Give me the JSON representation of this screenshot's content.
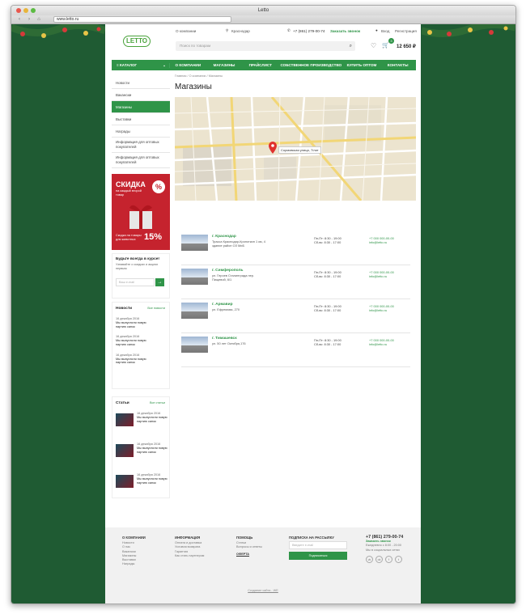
{
  "window": {
    "title": "Letto",
    "url": "www.letto.ru"
  },
  "topbar": {
    "about": "О компании",
    "city": "Краснодар",
    "phone": "+7 (861) 279-00-74",
    "callback": "Заказать звонок",
    "login": "Вход",
    "register": "Регистрация"
  },
  "header": {
    "logo": "LETTO",
    "search_placeholder": "Поиск по товарам",
    "cart_count": "3",
    "cart_total": "12 650 ₽"
  },
  "mainnav": {
    "catalog": "КАТАЛОГ",
    "items": [
      "О КОМПАНИИ",
      "МАГАЗИНЫ",
      "ПРАЙСЛИСТ",
      "СОБСТВЕННОЕ ПРОИЗВОДСТВО",
      "КУПИТЬ ОПТОМ",
      "КОНТАКТЫ"
    ]
  },
  "sidebar": {
    "items": [
      "Новости",
      "Вакансии",
      "Магазины",
      "Выставки",
      "Награды",
      "Информация для оптовых покупателей",
      "Информация для оптовых покупателей"
    ],
    "active": 2
  },
  "promo": {
    "title": "СКИДКА",
    "sub": "на каждый второй товар",
    "line2": "Скидка на товары для животных",
    "percent": "15%",
    "badge": "%"
  },
  "subscribe": {
    "title": "Будьте всегда в курсе!",
    "text": "Узнавайте о скидках и акциях первым",
    "placeholder": "Ваш e-mail"
  },
  "news": {
    "title": "Новости",
    "all": "Все новости",
    "items": [
      {
        "date": "16 декабря 2016",
        "text": "Мы выпустили новую партию санок"
      },
      {
        "date": "16 декабря 2016",
        "text": "Мы выпустили новую партию санок"
      },
      {
        "date": "16 декабря 2016",
        "text": "Мы выпустили новую партию санок"
      }
    ]
  },
  "articles": {
    "title": "Статьи",
    "all": "Все статьи",
    "items": [
      {
        "date": "16 декабря 2016",
        "text": "Мы выпустили новую партию санок"
      },
      {
        "date": "16 декабря 2016",
        "text": "Мы выпустили новую партию санок"
      },
      {
        "date": "16 декабря 2016",
        "text": "Мы выпустили новую партию санок"
      }
    ]
  },
  "content": {
    "breadcrumb": "Главная  /  О компании  /  Магазины",
    "title": "Магазины",
    "map_label": "Сормовская улица, 7/лит"
  },
  "stores": [
    {
      "city": "г. Краснодар",
      "address": "Трасса Краснодар-Кропоткин 1 км, 4 здание район ОЗ МиБ",
      "hours1": "Пн-Пт: 8:30 - 19:00",
      "hours2": "Сб-вс: 8:30 - 17:00",
      "phone": "+7 000 000-00-00",
      "email": "info@letto.ru"
    },
    {
      "city": "г. Симферополь",
      "address": "ул. Героев Сталинграда пер. Пищевой, 6/1",
      "hours1": "Пн-Пт: 8:30 - 19:00",
      "hours2": "Сб-вс: 8:30 - 17:00",
      "phone": "+7 000 000-00-00",
      "email": "info@letto.ru"
    },
    {
      "city": "г. Армавир",
      "address": "ул. Ефремова, 270",
      "hours1": "Пн-Пт: 8:30 - 19:00",
      "hours2": "Сб-вс: 8:30 - 17:00",
      "phone": "+7 000 000-00-00",
      "email": "info@letto.ru"
    },
    {
      "city": "г. Тимашевск",
      "address": "ул. 50 лет Октября,176",
      "hours1": "Пн-Пт: 8:30 - 19:00",
      "hours2": "Сб-вс: 8:30 - 17:00",
      "phone": "+7 000 000-00-00",
      "email": "info@letto.ru"
    }
  ],
  "footer": {
    "col1": {
      "title": "О КОМПАНИИ",
      "items": [
        "Новости",
        "О нас",
        "Вакансии",
        "Магазины",
        "Выставки",
        "Награды"
      ]
    },
    "col2": {
      "title": "ИНФОРМАЦИЯ",
      "items": [
        "Оплата и доставка",
        "Условия возврата",
        "Гарантия",
        "Как стать партнером"
      ]
    },
    "col3": {
      "title": "ПОМОЩЬ",
      "items": [
        "Статьи",
        "Вопросы и ответы"
      ],
      "offer": "ОФЕРТА"
    },
    "col4": {
      "title": "ПОДПИСКА НА РАССЫЛКУ",
      "placeholder": "Введите e-mail",
      "button": "Подписаться"
    },
    "col5": {
      "phone": "+7 (861) 279-00-74",
      "callback": "Заказать звонок",
      "hours": "Ежедневно с 8:00 - 20:00",
      "social": "Мы в социальных сетях"
    },
    "credit": "Создание сайта - WE"
  },
  "colors": {
    "brand": "#2f9448",
    "bg": "#1f5b33",
    "promo": "#c5232e"
  }
}
